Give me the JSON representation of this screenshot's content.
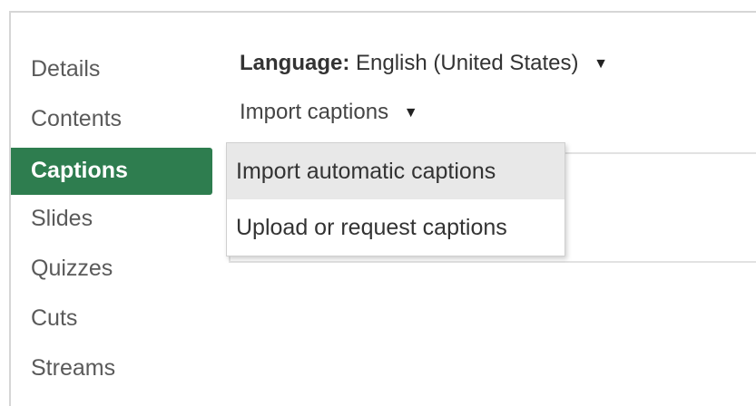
{
  "sidebar": {
    "items": [
      {
        "label": "Details"
      },
      {
        "label": "Contents"
      },
      {
        "label": "Captions"
      },
      {
        "label": "Slides"
      },
      {
        "label": "Quizzes"
      },
      {
        "label": "Cuts"
      },
      {
        "label": "Streams"
      }
    ],
    "active_index": 2,
    "active_color": "#2e7d4f"
  },
  "language": {
    "label": "Language:",
    "value": "English (United States)",
    "caret_icon": "caret-down-icon"
  },
  "import_captions": {
    "label": "Import captions",
    "caret_icon": "caret-down-icon"
  },
  "dropdown": {
    "items": [
      {
        "label": "Import automatic captions",
        "highlighted": true
      },
      {
        "label": "Upload or request captions",
        "highlighted": false
      }
    ]
  }
}
